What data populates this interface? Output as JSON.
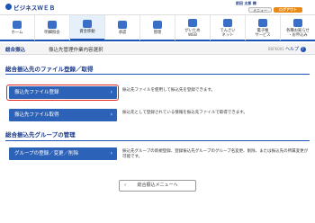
{
  "header": {
    "brand_mark": "みずほ",
    "brand_name": "ビジネスＷＥＢ",
    "user_label": "前田 太郎 様",
    "user_timestamp": "2014年07月30日 09時00分",
    "menu_button": "メニュー",
    "logout_button": "ログアウト"
  },
  "nav": {
    "items": [
      {
        "label": "ホーム",
        "icon": "home-icon"
      },
      {
        "label": "明細照会",
        "icon": "statement-icon"
      },
      {
        "label": "資金移動",
        "icon": "transfer-icon"
      },
      {
        "label": "承認",
        "icon": "approval-icon"
      },
      {
        "label": "管理",
        "icon": "admin-icon"
      },
      {
        "label": "がいため\nWEB",
        "icon": "forex-icon"
      },
      {
        "label": "でんさい\nネット",
        "icon": "densai-icon"
      },
      {
        "label": "電子帳\nサービス",
        "icon": "ebook-icon"
      },
      {
        "label": "各種お知らせ\n・お申込み",
        "icon": "notice-icon"
      }
    ]
  },
  "breadcrumb": {
    "section": "総合振込",
    "page": "振込先管理作業内容選択",
    "screen_id": "BSFK001",
    "help": "ヘルプ",
    "help_icon": "question-icon"
  },
  "main": {
    "section1_title": "総合振込先のファイル登録／取得",
    "actions1": [
      {
        "label": "振込先ファイル登録",
        "desc": "振込先ファイルを使用して振込先を登録できます。"
      },
      {
        "label": "振込先ファイル取得",
        "desc": "振込先として登録されている情報を振込先ファイルで取得できます。"
      }
    ],
    "section2_title": "総合振込先グループの管理",
    "actions2": [
      {
        "label": "グループの登録／変更／削除",
        "desc": "振込先グループの新規登録、登録振込先グループのグループ名変更、削除、または振込先の所属変更が可能です。"
      }
    ],
    "back_button": "総合振込メニューへ"
  },
  "colors": {
    "accent": "#1a55b5",
    "button": "#2c62b8",
    "highlight": "#e32424",
    "logout": "#e88a18"
  }
}
